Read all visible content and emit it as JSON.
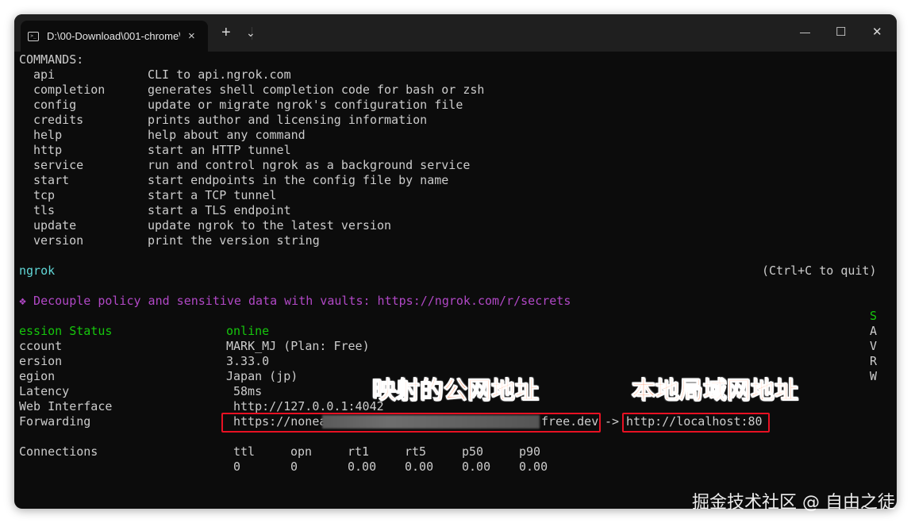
{
  "window": {
    "tab_title": "D:\\00-Download\\001-chrome\\",
    "tab_close": "×",
    "new_tab": "+",
    "dropdown": "⌄",
    "minimize": "—",
    "maximize": "☐",
    "close": "✕"
  },
  "commands_header": "COMMANDS:",
  "commands": [
    {
      "name": "api",
      "desc": "CLI to api.ngrok.com"
    },
    {
      "name": "completion",
      "desc": "generates shell completion code for bash or zsh"
    },
    {
      "name": "config",
      "desc": "update or migrate ngrok's configuration file"
    },
    {
      "name": "credits",
      "desc": "prints author and licensing information"
    },
    {
      "name": "help",
      "desc": "help about any command"
    },
    {
      "name": "http",
      "desc": "start an HTTP tunnel"
    },
    {
      "name": "service",
      "desc": "run and control ngrok as a background service"
    },
    {
      "name": "start",
      "desc": "start endpoints in the config file by name"
    },
    {
      "name": "tcp",
      "desc": "start a TCP tunnel"
    },
    {
      "name": "tls",
      "desc": "start a TLS endpoint"
    },
    {
      "name": "update",
      "desc": "update ngrok to the latest version"
    },
    {
      "name": "version",
      "desc": "print the version string"
    }
  ],
  "status": {
    "brand": "ngrok",
    "quit_hint": "(Ctrl+C to quit)",
    "promo": "❖ Decouple policy and sensitive data with vaults: https://ngrok.com/r/secrets",
    "side_letters": [
      "S",
      "A",
      "V",
      "R",
      "W"
    ],
    "rows": [
      {
        "label": "ession Status",
        "value": "online"
      },
      {
        "label": "ccount",
        "value": "MARK_MJ (Plan: Free)"
      },
      {
        "label": "ersion",
        "value": "3.33.0"
      },
      {
        "label": "egion",
        "value": "Japan (jp)"
      },
      {
        "label": "Latency",
        "value": "58ms"
      },
      {
        "label": "Web Interface",
        "value": "http://127.0.0.1:4042"
      }
    ],
    "forwarding": {
      "label": "Forwarding",
      "url_start": "https://nonea",
      "url_end": "free.dev",
      "arrow": "->",
      "local": "http://localhost:80"
    },
    "connections": {
      "label": "Connections",
      "headers": [
        "ttl",
        "opn",
        "rt1",
        "rt5",
        "p50",
        "p90"
      ],
      "values": [
        "0",
        "0",
        "0.00",
        "0.00",
        "0.00",
        "0.00"
      ]
    }
  },
  "annotations": {
    "public": "映射的公网地址",
    "local": "本地局域网地址"
  },
  "watermark": "掘金技术社区 @ 自由之徒",
  "colors": {
    "background": "#0c0c0c",
    "text": "#cccccc",
    "cyan": "#61d6d6",
    "purple": "#b148c6",
    "green": "#16c60c",
    "highlight_box": "#e81123",
    "annotation": "#ff6a2a"
  }
}
